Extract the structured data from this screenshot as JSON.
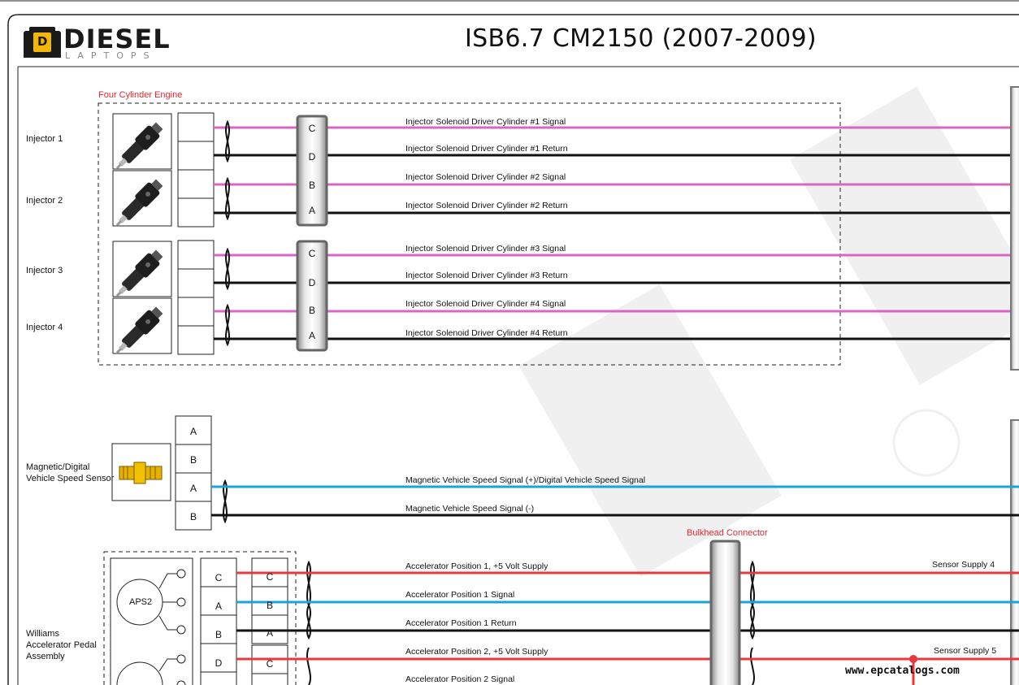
{
  "header": {
    "title": "ISB6.7 CM2150 (2007-2009)",
    "logo_main": "DIESEL",
    "logo_sub": "LAPTOPS",
    "logo_badge": "D"
  },
  "groups": {
    "engine_label": "Four Cylinder Engine",
    "bulkhead_label": "Bulkhead Connector"
  },
  "components": {
    "injector1": "Injector 1",
    "injector2": "Injector 2",
    "injector3": "Injector 3",
    "injector4": "Injector 4",
    "vss_line1": "Magnetic/Digital",
    "vss_line2": "Vehicle Speed Sensor",
    "pedal_line1": "Williams",
    "pedal_line2": "Accelerator Pedal",
    "pedal_line3": "Assembly",
    "aps2": "APS2"
  },
  "pins": {
    "conn1": [
      "C",
      "D",
      "B",
      "A"
    ],
    "conn2": [
      "C",
      "D",
      "B",
      "A"
    ],
    "vss": [
      "A",
      "B",
      "A",
      "B"
    ],
    "pedal_a": [
      "C",
      "A",
      "B",
      "D"
    ],
    "pedal_b": [
      "C",
      "B",
      "A",
      "C"
    ]
  },
  "signals": {
    "inj1_sig": "Injector Solenoid Driver Cylinder #1 Signal",
    "inj1_ret": "Injector Solenoid Driver Cylinder #1 Return",
    "inj2_sig": "Injector Solenoid Driver Cylinder #2 Signal",
    "inj2_ret": "Injector Solenoid Driver Cylinder #2 Return",
    "inj3_sig": "Injector Solenoid Driver Cylinder #3 Signal",
    "inj3_ret": "Injector Solenoid Driver Cylinder #3 Return",
    "inj4_sig": "Injector Solenoid Driver Cylinder #4 Signal",
    "inj4_ret": "Injector Solenoid Driver Cylinder #4 Return",
    "vss_pos": "Magnetic Vehicle Speed Signal (+)/Digital Vehicle Speed Signal",
    "vss_neg": "Magnetic Vehicle Speed Signal (-)",
    "ap1_supply": "Accelerator Position 1, +5 Volt Supply",
    "ap1_signal": "Accelerator Position 1 Signal",
    "ap1_return": "Accelerator Position 1 Return",
    "ap2_supply": "Accelerator Position 2, +5 Volt Supply",
    "ap2_signal": "Accelerator Position 2 Signal",
    "sensor_supply4": "Sensor Supply 4",
    "sensor_supply5": "Sensor Supply 5"
  },
  "colors": {
    "injector_signal": "#d966c6",
    "return": "#111111",
    "speed_signal": "#1aa3dd",
    "supply": "#e8383d",
    "group_label": "#e8272f"
  },
  "footer": {
    "url": "www.epcatalogs.com"
  }
}
